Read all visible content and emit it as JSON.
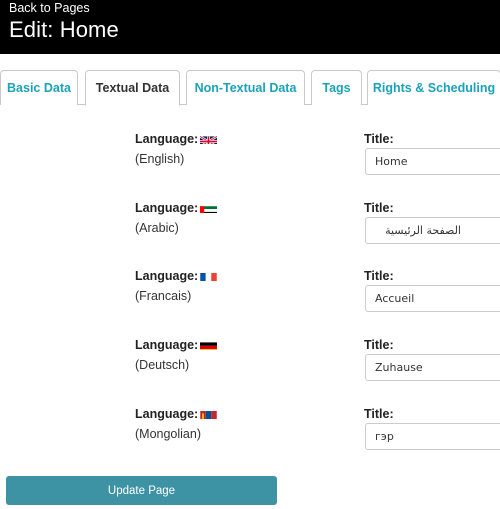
{
  "header": {
    "back_label": "Back to Pages",
    "title": "Edit: Home",
    "background": "#000000"
  },
  "tabs": [
    {
      "label": "Basic Data",
      "active": false
    },
    {
      "label": "Textual Data",
      "active": true
    },
    {
      "label": "Non-Textual Data",
      "active": false
    },
    {
      "label": "Tags",
      "active": false
    },
    {
      "label": "Rights & Scheduling",
      "active": false
    }
  ],
  "languages": [
    {
      "label": "Language:",
      "name": "(English)",
      "flag_icon": "uk-flag-icon",
      "title_label": "Title:",
      "title_value": "Home"
    },
    {
      "label": "Language:",
      "name": "(Arabic)",
      "flag_icon": "uae-flag-icon",
      "title_label": "Title:",
      "title_value": "الصفحة الرئيسية"
    },
    {
      "label": "Language:",
      "name": "(Francais)",
      "flag_icon": "france-flag-icon",
      "title_label": "Title:",
      "title_value": "Accueil"
    },
    {
      "label": "Language:",
      "name": "(Deutsch)",
      "flag_icon": "germany-flag-icon",
      "title_label": "Title:",
      "title_value": "Zuhause"
    },
    {
      "label": "Language:",
      "name": "(Mongolian)",
      "flag_icon": "mongolia-flag-icon",
      "title_label": "Title:",
      "title_value": "гэр"
    }
  ],
  "update_button": {
    "label": "Update Page",
    "color": "#3d93a4"
  },
  "colors": {
    "tab_link": "#1aa3b8",
    "tab_active": "#333333",
    "border": "#c9c9c9"
  }
}
